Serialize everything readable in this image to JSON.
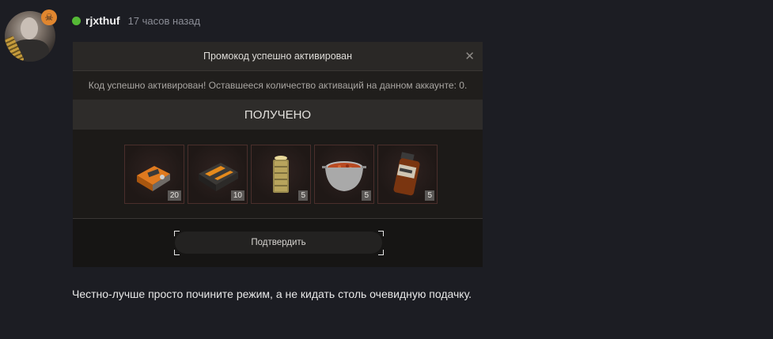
{
  "post": {
    "username": "rjxthuf",
    "timestamp": "17 часов назад",
    "comment": "Честно-лучше просто почините режим, а не кидать столь очевидную подачку."
  },
  "dialog": {
    "title": "Промокод успешно активирован",
    "close_glyph": "✕",
    "message": "Код успешно активирован! Оставшееся количество активаций на данном аккаунте: 0.",
    "received_label": "ПОЛУЧЕНО",
    "items": [
      {
        "icon": "toolbox-icon",
        "count": "20"
      },
      {
        "icon": "ammo-crate-icon",
        "count": "10"
      },
      {
        "icon": "battery-icon",
        "count": "5"
      },
      {
        "icon": "food-pot-icon",
        "count": "5"
      },
      {
        "icon": "medicine-jar-icon",
        "count": "5"
      }
    ],
    "confirm_label": "Подтвердить"
  },
  "colors": {
    "background": "#1c1d23",
    "online": "#55b936",
    "badge": "#e0862f"
  }
}
